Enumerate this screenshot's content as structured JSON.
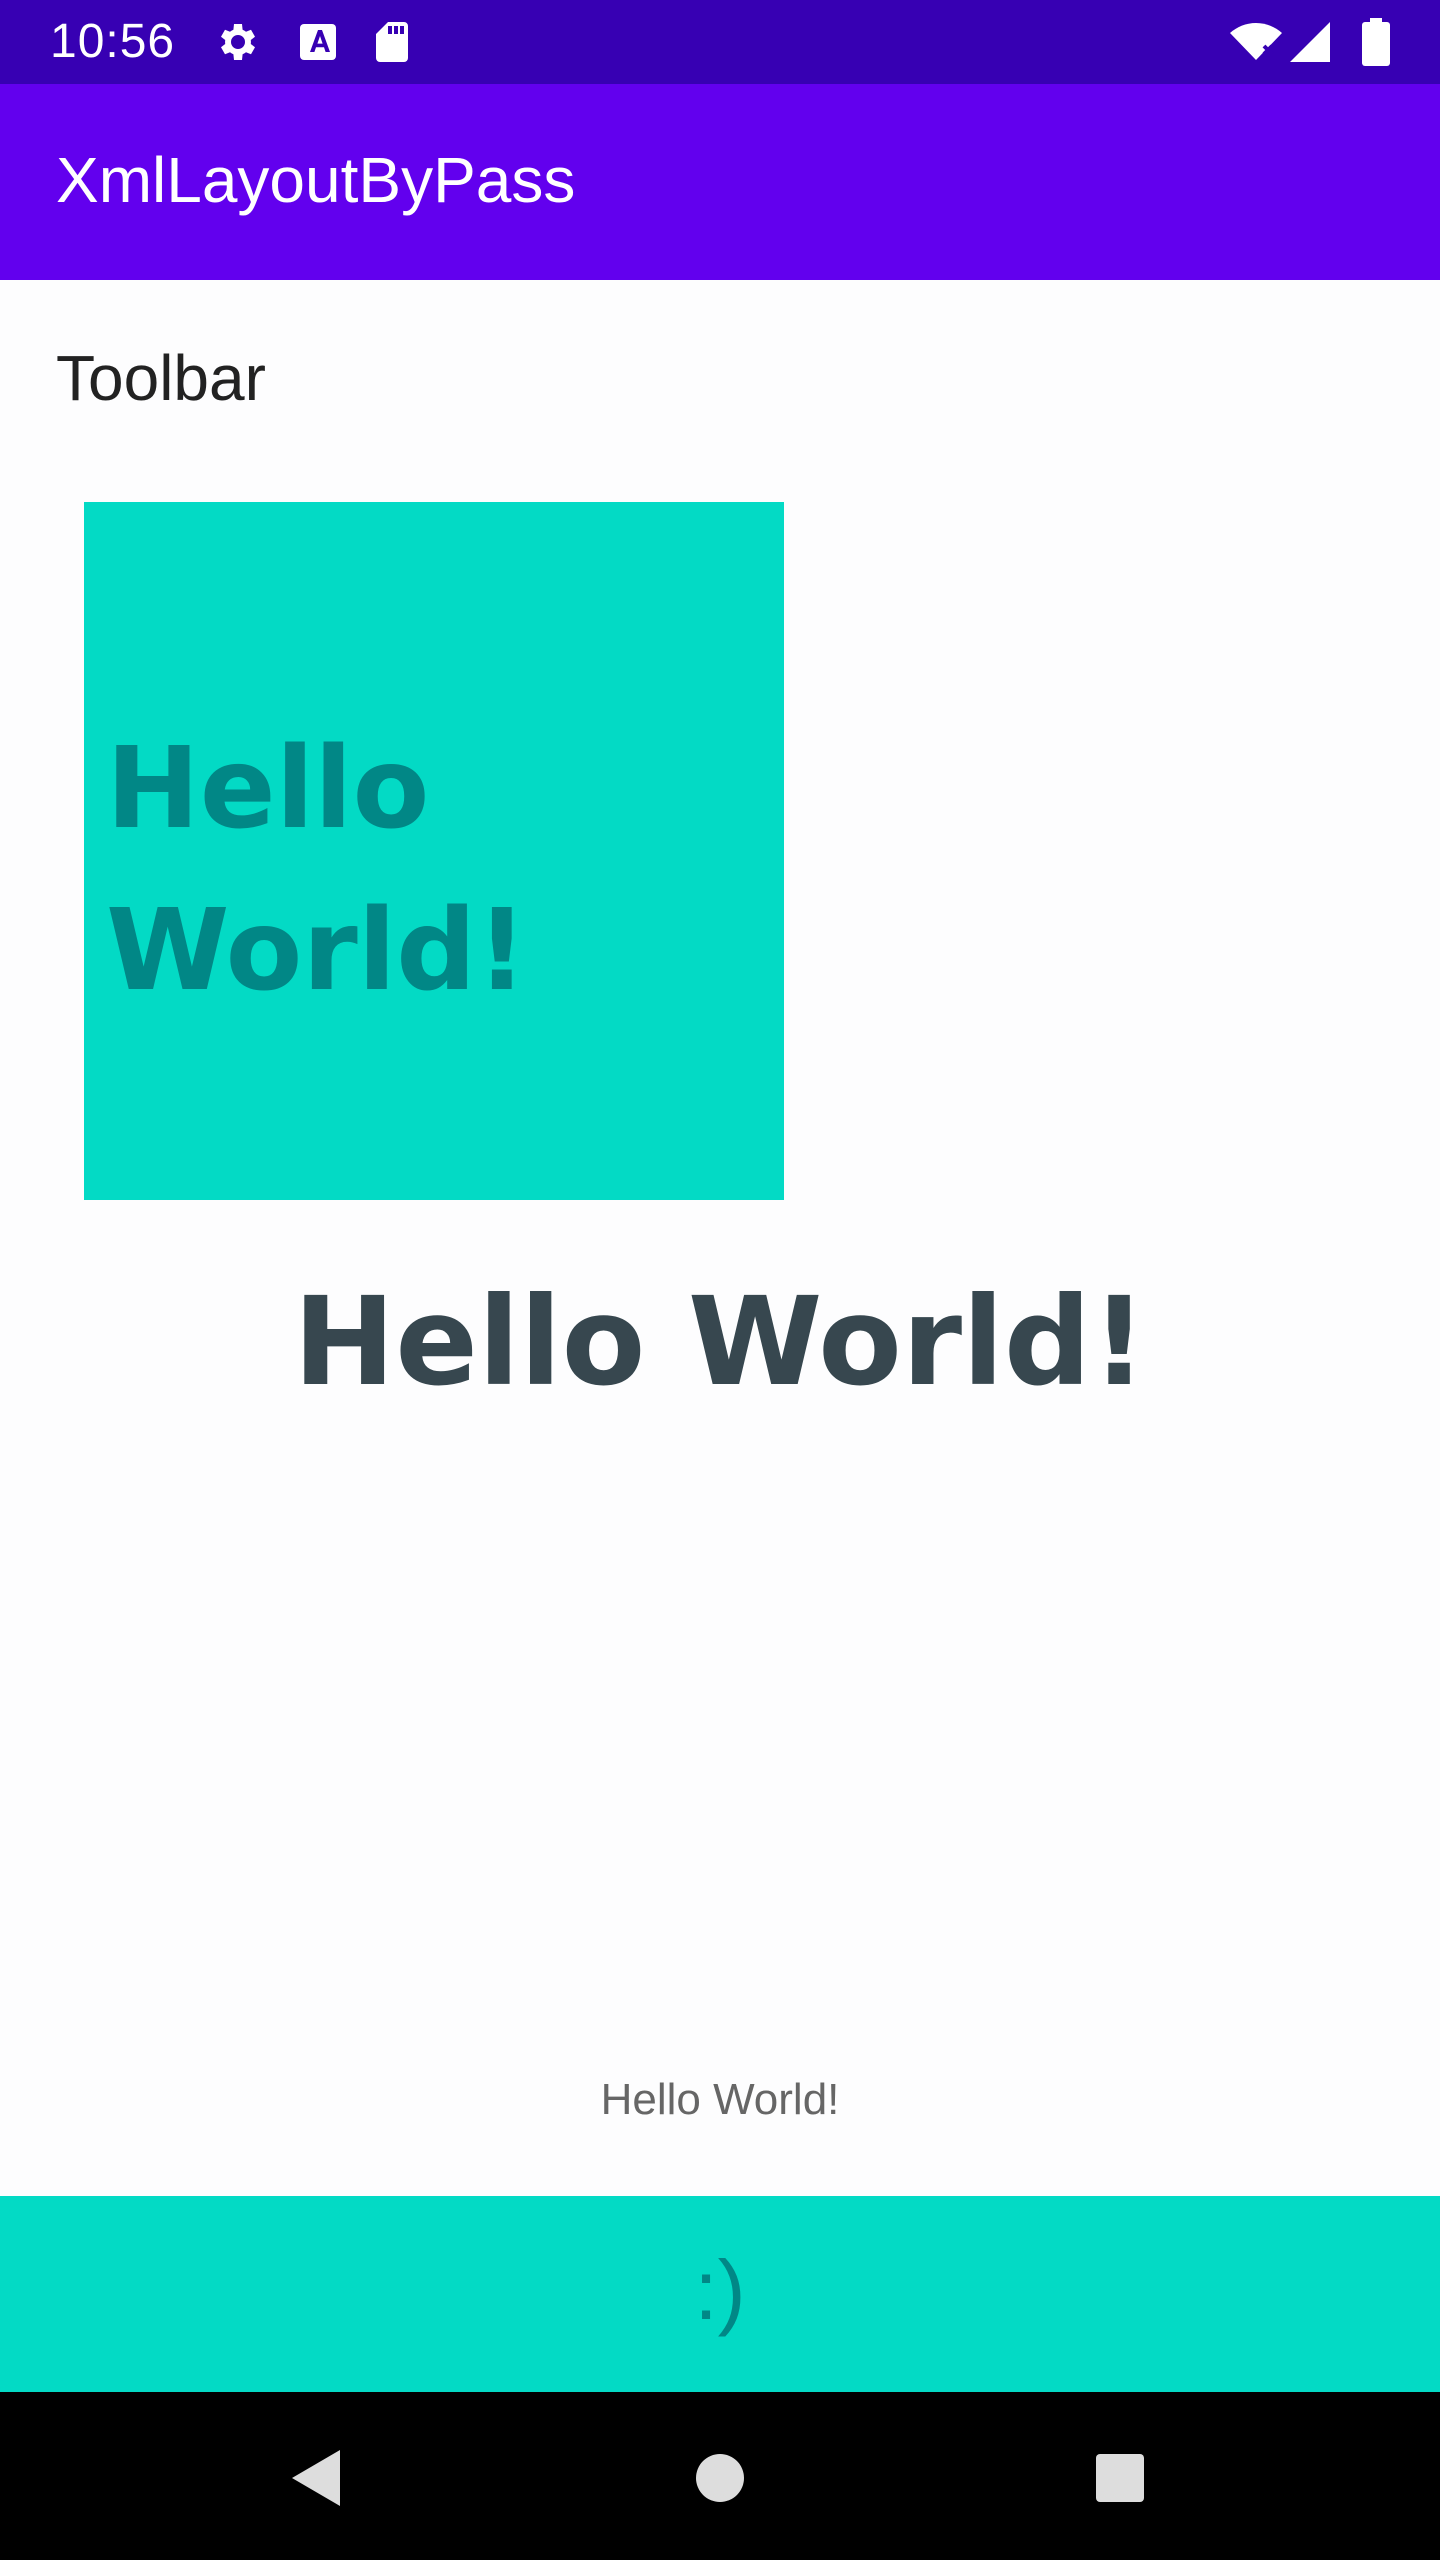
{
  "status_bar": {
    "time": "10:56",
    "icons": [
      "gear-icon",
      "a-icon",
      "sd-card-icon",
      "wifi-icon",
      "signal-icon",
      "battery-icon"
    ],
    "background": "#3700b3"
  },
  "app_bar": {
    "title": "XmlLayoutByPass",
    "background": "#6200ee"
  },
  "content": {
    "toolbar_label": "Toolbar",
    "box_text_line1": "Hello",
    "box_text_line2": "World!",
    "large_text": "Hello World!",
    "small_text": "Hello World!",
    "bottom_text": ":)",
    "accent_color": "#03dac5",
    "accent_text_color": "#018786"
  },
  "nav_bar": {
    "buttons": [
      "back-icon",
      "home-icon",
      "recents-icon"
    ]
  }
}
